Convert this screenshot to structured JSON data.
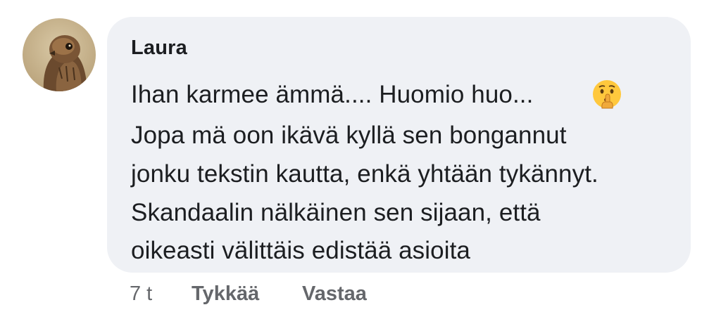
{
  "comment": {
    "author": "Laura",
    "lines": [
      "Ihan karmee ämmä.... Huomio huo...",
      "Jopa mä oon ikävä kyllä sen bongannut",
      "jonku tekstin kautta, enkä yhtään tykännyt.",
      "Skandaalin nälkäinen sen sijaan, että",
      "oikeasti välittäis edistää asioita"
    ],
    "emoji_icon": "shushing-face-icon",
    "timestamp": "7 t",
    "like_label": "Tykkää",
    "reply_label": "Vastaa"
  },
  "colors": {
    "bubble": "#eff1f5",
    "text": "#1c1e21",
    "meta": "#65676b"
  }
}
